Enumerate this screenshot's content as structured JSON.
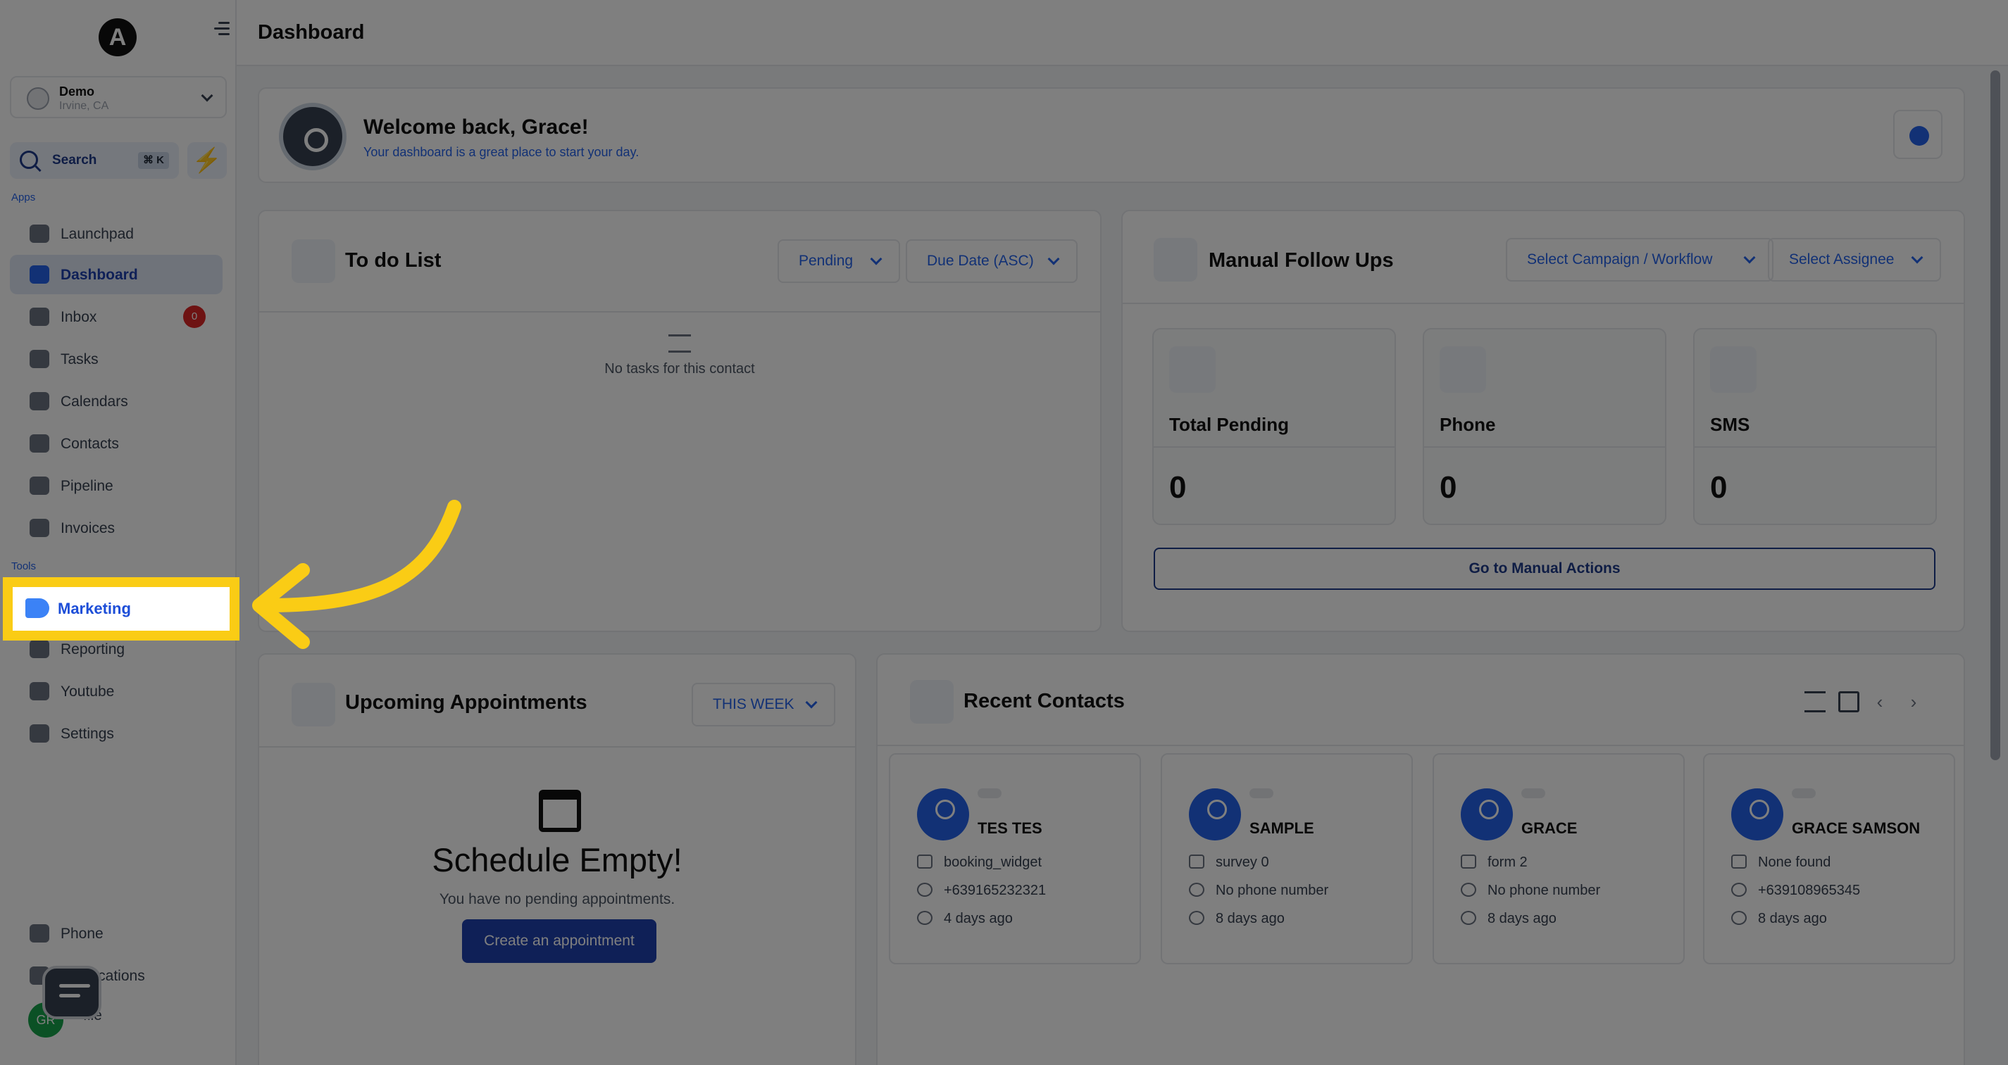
{
  "app": {
    "logo_letter": "A",
    "page_title": "Dashboard"
  },
  "account": {
    "name": "Demo",
    "location": "Irvine, CA"
  },
  "search": {
    "label": "Search",
    "shortcut": "⌘ K"
  },
  "sidebar": {
    "apps_label": "Apps",
    "tools_label": "Tools",
    "apps": [
      {
        "label": "Launchpad",
        "icon": "rocket-icon"
      },
      {
        "label": "Dashboard",
        "icon": "dashboard-icon",
        "active": true
      },
      {
        "label": "Inbox",
        "icon": "inbox-icon",
        "badge": "0"
      },
      {
        "label": "Tasks",
        "icon": "tasks-icon"
      },
      {
        "label": "Calendars",
        "icon": "calendar-icon"
      },
      {
        "label": "Contacts",
        "icon": "contacts-icon"
      },
      {
        "label": "Pipeline",
        "icon": "funnel-icon"
      },
      {
        "label": "Invoices",
        "icon": "invoice-icon"
      }
    ],
    "tools": [
      {
        "label": "Marketing",
        "icon": "megaphone-icon",
        "highlighted": true
      },
      {
        "label": "Reporting",
        "icon": "chart-icon"
      },
      {
        "label": "Youtube",
        "icon": "youtube-icon"
      },
      {
        "label": "Settings",
        "icon": "gear-icon"
      }
    ],
    "bottom": [
      {
        "label": "Phone",
        "icon": "phone-icon"
      },
      {
        "label": "ifications",
        "icon": "bell-icon"
      },
      {
        "label": "file",
        "icon": "profile-icon"
      }
    ],
    "avatar_initials": "GR"
  },
  "welcome": {
    "greeting": "Welcome back, Grace!",
    "subtitle": "Your dashboard is a great place to start your day."
  },
  "todo": {
    "title": "To do List",
    "filter_status": "Pending",
    "filter_sort": "Due Date (ASC)",
    "empty_text": "No tasks for this contact"
  },
  "follow_ups": {
    "title": "Manual Follow Ups",
    "campaign_select": "Select Campaign / Workflow",
    "assignee_select": "Select Assignee",
    "stats": [
      {
        "label": "Total Pending",
        "value": "0",
        "icon": "checklist-icon"
      },
      {
        "label": "Phone",
        "value": "0",
        "icon": "phone-icon"
      },
      {
        "label": "SMS",
        "value": "0",
        "icon": "message-icon"
      }
    ],
    "action_button": "Go to Manual Actions"
  },
  "appointments": {
    "title": "Upcoming Appointments",
    "range": "THIS WEEK",
    "empty_title": "Schedule Empty!",
    "empty_text": "You have no pending appointments.",
    "create_button": "Create an appointment"
  },
  "recent_contacts": {
    "title": "Recent Contacts",
    "contacts": [
      {
        "name": "TES TES",
        "source": "booking_widget",
        "phone": "+639165232321",
        "added": "4 days ago"
      },
      {
        "name": "SAMPLE",
        "source": "survey 0",
        "phone": "No phone number",
        "added": "8 days ago"
      },
      {
        "name": "GRACE",
        "source": "form 2",
        "phone": "No phone number",
        "added": "8 days ago"
      },
      {
        "name": "GRACE SAMSON",
        "source": "None found",
        "phone": "+639108965345",
        "added": "8 days ago"
      }
    ]
  },
  "colors": {
    "accent": "#2563eb",
    "highlight": "#facc15",
    "badge": "#dc2626"
  }
}
